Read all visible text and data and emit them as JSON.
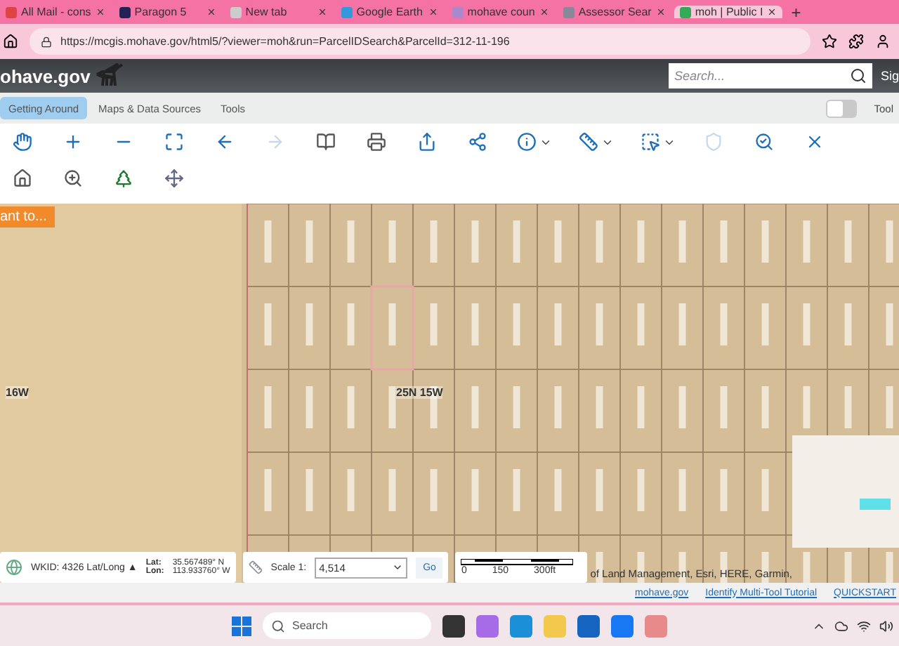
{
  "browser": {
    "tabs": [
      {
        "title": "All Mail - cons",
        "selected": false
      },
      {
        "title": "Paragon 5",
        "selected": false
      },
      {
        "title": "New tab",
        "selected": false
      },
      {
        "title": "Google Earth",
        "selected": false
      },
      {
        "title": "mohave coun",
        "selected": false
      },
      {
        "title": "Assessor Sear",
        "selected": false
      },
      {
        "title": "moh | Public I",
        "selected": true
      }
    ],
    "new_tab": "+",
    "url": "https://mcgis.mohave.gov/html5/?viewer=moh&run=ParcelIDSearch&ParcelId=312-11-196"
  },
  "site": {
    "logo": "ohave.gov",
    "search": {
      "placeholder": "Search..."
    },
    "sign_in": "Sig"
  },
  "menu_tabs": [
    {
      "label": "Getting Around",
      "selected": true
    },
    {
      "label": "Maps & Data Sources",
      "selected": false
    },
    {
      "label": "Tools",
      "selected": false
    }
  ],
  "tool_toggle": {
    "label": "Tool",
    "on": false
  },
  "toolbar": [
    {
      "disabled": false,
      "menu": false
    },
    {
      "disabled": false,
      "menu": false
    },
    {
      "disabled": false,
      "menu": false
    },
    {
      "disabled": false,
      "menu": false
    },
    {
      "disabled": false,
      "menu": false
    },
    {
      "disabled": true,
      "menu": false
    },
    {
      "disabled": false,
      "menu": false
    },
    {
      "disabled": false,
      "menu": false
    },
    {
      "disabled": false,
      "menu": false
    },
    {
      "disabled": false,
      "menu": false
    },
    {
      "disabled": false,
      "menu": true
    },
    {
      "disabled": false,
      "menu": true
    },
    {
      "disabled": false,
      "menu": true
    },
    {
      "disabled": true,
      "menu": false
    },
    {
      "disabled": false,
      "menu": false
    },
    {
      "disabled": false,
      "menu": false
    }
  ],
  "map": {
    "want_button": "ant to...",
    "labels": [
      {
        "text": "16W"
      },
      {
        "text": "25N 15W"
      }
    ]
  },
  "status": {
    "wkid": "WKID: 4326 Lat/Long ▲",
    "lat_label": "Lat:",
    "lat": "35.567489° N",
    "lon_label": "Lon:",
    "lon": "113.933760° W",
    "scale_label": "Scale 1:",
    "scale": "4,514",
    "go": "Go",
    "scalebar": [
      "0",
      "150",
      "300ft"
    ],
    "attribution": "of Land Management, Esri, HERE, Garmin,"
  },
  "footer_links": [
    "mohave.gov",
    "Identify Multi-Tool Tutorial",
    "QUICKSTART"
  ],
  "taskbar": {
    "search": {
      "placeholder": "Search"
    }
  }
}
